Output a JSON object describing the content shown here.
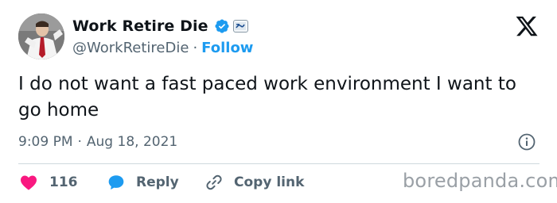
{
  "author": {
    "display_name": "Work Retire Die",
    "handle": "@WorkRetireDie",
    "follow_label": "Follow",
    "separator": "·"
  },
  "tweet": {
    "text": "I do not want a fast paced work environment I want to go home",
    "time": "9:09 PM",
    "date": "Aug 18, 2021",
    "separator": "·"
  },
  "actions": {
    "like_count": "116",
    "reply_label": "Reply",
    "copy_link_label": "Copy link"
  },
  "icons": {
    "verified": "verified-badge-icon",
    "affiliate": "affiliate-badge-icon",
    "brand": "x-logo-icon",
    "info": "info-icon",
    "like": "heart-icon",
    "reply": "speech-bubble-icon",
    "copy": "link-icon"
  },
  "colors": {
    "accent": "#1d9bf0",
    "heart": "#f91880",
    "text": "#0f1419",
    "muted": "#536471"
  },
  "watermark": "boredpanda.com"
}
